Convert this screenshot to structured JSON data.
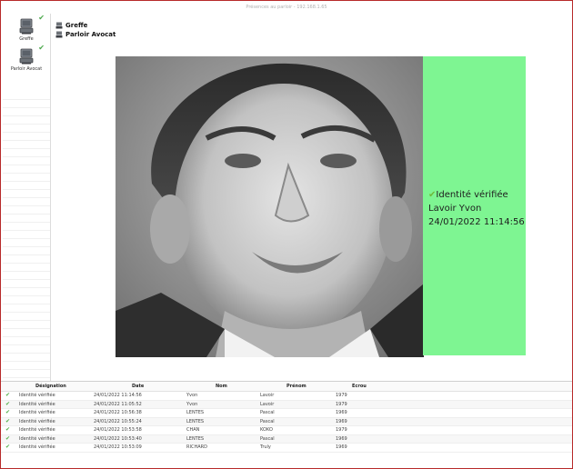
{
  "window": {
    "title": "Présences au parloir - 192.168.1.65"
  },
  "sidebar": {
    "items": [
      {
        "label": "Greffe",
        "checked": true
      },
      {
        "label": "Parloir Avocat",
        "checked": true
      }
    ]
  },
  "tree": {
    "items": [
      "Greffe",
      "Parloir Avocat"
    ]
  },
  "status": {
    "icon": "checkmark-icon",
    "title": "Identité vérifiée",
    "name": "Lavoir Yvon",
    "datetime": "24/01/2022 11:14:56",
    "color": "#7ef592"
  },
  "table": {
    "headers": {
      "designation": "Désignation",
      "date": "Date",
      "nom": "Nom",
      "prenom": "Prénom",
      "ecrou": "Ecrou"
    },
    "rows": [
      {
        "designation": "Identité vérifiée",
        "date": "24/01/2022 11:14:56",
        "nom": "Yvon",
        "prenom": "Lavoir",
        "ecrou": "1979"
      },
      {
        "designation": "Identité vérifiée",
        "date": "24/01/2022 11:05:52",
        "nom": "Yvon",
        "prenom": "Lavoir",
        "ecrou": "1979"
      },
      {
        "designation": "Identité vérifiée",
        "date": "24/01/2022 10:56:38",
        "nom": "LENTES",
        "prenom": "Pascal",
        "ecrou": "1969"
      },
      {
        "designation": "Identité vérifiée",
        "date": "24/01/2022 10:55:24",
        "nom": "LENTES",
        "prenom": "Pascal",
        "ecrou": "1969"
      },
      {
        "designation": "Identité vérifiée",
        "date": "24/01/2022 10:53:58",
        "nom": "CHAN",
        "prenom": "KOKO",
        "ecrou": "1979"
      },
      {
        "designation": "Identité vérifiée",
        "date": "24/01/2022 10:53:40",
        "nom": "LENTES",
        "prenom": "Pascal",
        "ecrou": "1969"
      },
      {
        "designation": "Identité vérifiée",
        "date": "24/01/2022 10:53:09",
        "nom": "RICHARD",
        "prenom": "Truly",
        "ecrou": "1969"
      }
    ]
  }
}
